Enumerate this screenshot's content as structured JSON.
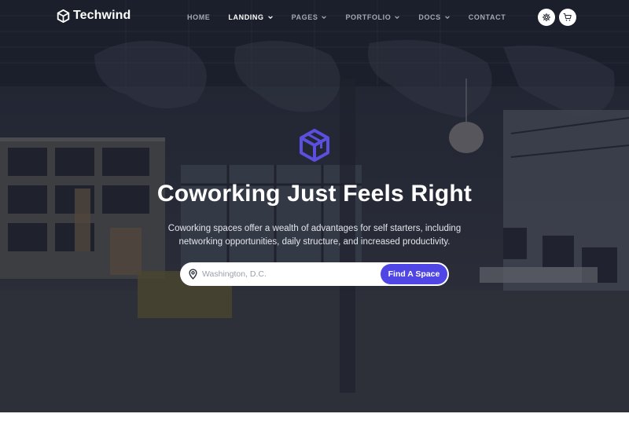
{
  "brand": {
    "name": "Techwind"
  },
  "nav": {
    "items": [
      {
        "label": "HOME",
        "dropdown": false,
        "active": false
      },
      {
        "label": "LANDING",
        "dropdown": true,
        "active": true
      },
      {
        "label": "PAGES",
        "dropdown": true,
        "active": false
      },
      {
        "label": "PORTFOLIO",
        "dropdown": true,
        "active": false
      },
      {
        "label": "DOCS",
        "dropdown": true,
        "active": false
      },
      {
        "label": "CONTACT",
        "dropdown": false,
        "active": false
      }
    ],
    "actions": [
      {
        "icon": "gear-icon"
      },
      {
        "icon": "cart-icon"
      }
    ]
  },
  "hero": {
    "icon": "hexagon-cube-logo-icon",
    "title": "Coworking Just Feels Right",
    "subtitle": "Coworking spaces offer a wealth of advantages for self starters, including networking opportunities, daily structure, and increased productivity."
  },
  "search": {
    "icon": "map-pin-icon",
    "placeholder": "Washington, D.C.",
    "value": "",
    "button_label": "Find A Space"
  },
  "colors": {
    "accent": "#4f46e5",
    "hero_overlay": "#161a28",
    "nav_active": "#ffffff",
    "nav_inactive": "#a3a8b5"
  }
}
